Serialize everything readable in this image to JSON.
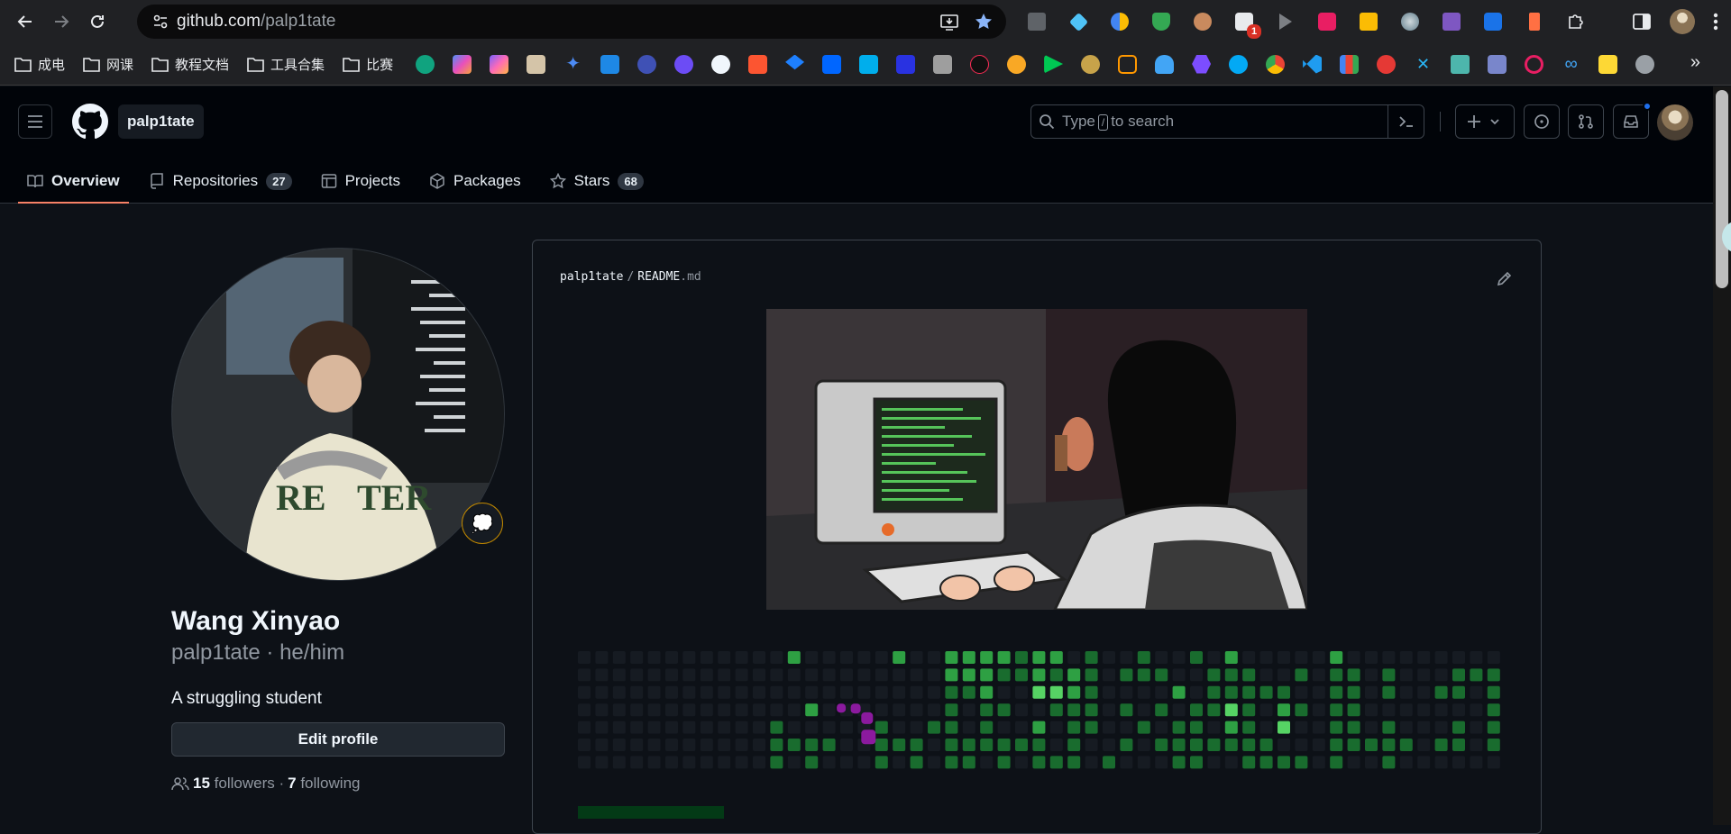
{
  "browser": {
    "url_host": "github.com",
    "url_path": "/palp1tate",
    "extension_badge": "1"
  },
  "bookmarks": {
    "folders": [
      "成电",
      "网课",
      "教程文档",
      "工具合集",
      "比赛"
    ],
    "more": "»"
  },
  "header": {
    "owner": "palp1tate",
    "search_label": "Type",
    "search_key": "/",
    "search_suffix": "to search"
  },
  "tabs": [
    {
      "label": "Overview"
    },
    {
      "label": "Repositories",
      "count": "27"
    },
    {
      "label": "Projects"
    },
    {
      "label": "Packages"
    },
    {
      "label": "Stars",
      "count": "68"
    }
  ],
  "profile": {
    "name": "Wang Xinyao",
    "login": "palp1tate · he/him",
    "bio": "A struggling student",
    "edit_label": "Edit profile",
    "followers_count": "15",
    "followers_label": "followers ·",
    "following_count": "7",
    "following_label": "following",
    "status_emoji": "💭"
  },
  "readme": {
    "owner": "palp1tate",
    "separator": "/",
    "file_base": "README",
    "file_ext": ".md"
  },
  "colors": {
    "accent_tab": "#f78166",
    "contrib_empty": "#161b22",
    "contrib_levels": [
      "#033a16",
      "#196c2e",
      "#2ea043",
      "#56d364"
    ],
    "snake": "#8b1a9e"
  },
  "contrib_grid": {
    "weeks": 53,
    "days": 7,
    "levels": [
      [
        0,
        0,
        0,
        0,
        0,
        0,
        0
      ],
      [
        0,
        0,
        0,
        0,
        0,
        0,
        0
      ],
      [
        0,
        0,
        0,
        0,
        0,
        0,
        0
      ],
      [
        0,
        0,
        0,
        0,
        0,
        0,
        0
      ],
      [
        0,
        0,
        0,
        0,
        0,
        0,
        0
      ],
      [
        0,
        0,
        0,
        0,
        0,
        0,
        0
      ],
      [
        0,
        0,
        0,
        0,
        0,
        0,
        0
      ],
      [
        0,
        0,
        0,
        0,
        0,
        0,
        0
      ],
      [
        0,
        0,
        0,
        0,
        0,
        0,
        0
      ],
      [
        0,
        0,
        0,
        0,
        0,
        0,
        0
      ],
      [
        0,
        0,
        0,
        0,
        0,
        0,
        0
      ],
      [
        0,
        0,
        0,
        0,
        1,
        1,
        1
      ],
      [
        2,
        0,
        0,
        0,
        0,
        1,
        0
      ],
      [
        0,
        0,
        0,
        2,
        0,
        1,
        1
      ],
      [
        0,
        0,
        0,
        0,
        0,
        1,
        0
      ],
      [
        0,
        0,
        0,
        0,
        0,
        0,
        0
      ],
      [
        0,
        0,
        0,
        0,
        0,
        0,
        0
      ],
      [
        0,
        0,
        0,
        0,
        1,
        1,
        1
      ],
      [
        2,
        0,
        0,
        0,
        0,
        1,
        0
      ],
      [
        0,
        0,
        0,
        0,
        0,
        1,
        1
      ],
      [
        0,
        0,
        0,
        0,
        1,
        0,
        0
      ],
      [
        2,
        2,
        1,
        1,
        1,
        1,
        1
      ],
      [
        2,
        2,
        1,
        0,
        0,
        1,
        1
      ],
      [
        2,
        2,
        2,
        1,
        1,
        1,
        0
      ],
      [
        2,
        1,
        0,
        1,
        0,
        1,
        1
      ],
      [
        1,
        1,
        0,
        0,
        0,
        1,
        0
      ],
      [
        2,
        2,
        3,
        0,
        2,
        1,
        1
      ],
      [
        2,
        1,
        3,
        1,
        0,
        0,
        1
      ],
      [
        0,
        2,
        2,
        1,
        1,
        1,
        1
      ],
      [
        1,
        1,
        1,
        1,
        1,
        0,
        0
      ],
      [
        0,
        0,
        0,
        0,
        0,
        0,
        1
      ],
      [
        0,
        1,
        0,
        1,
        0,
        1,
        0
      ],
      [
        1,
        1,
        0,
        0,
        1,
        0,
        0
      ],
      [
        0,
        1,
        0,
        1,
        0,
        1,
        0
      ],
      [
        0,
        0,
        2,
        0,
        1,
        1,
        1
      ],
      [
        1,
        0,
        0,
        1,
        1,
        1,
        1
      ],
      [
        0,
        1,
        1,
        1,
        0,
        1,
        0
      ],
      [
        2,
        1,
        1,
        3,
        2,
        1,
        0
      ],
      [
        0,
        1,
        1,
        1,
        1,
        1,
        1
      ],
      [
        0,
        0,
        1,
        0,
        0,
        1,
        1
      ],
      [
        0,
        0,
        1,
        2,
        3,
        0,
        1
      ],
      [
        0,
        1,
        0,
        1,
        0,
        0,
        1
      ],
      [
        0,
        0,
        0,
        0,
        0,
        0,
        0
      ],
      [
        2,
        1,
        1,
        1,
        1,
        1,
        1
      ],
      [
        0,
        1,
        1,
        1,
        1,
        1,
        0
      ],
      [
        0,
        0,
        0,
        0,
        0,
        1,
        0
      ],
      [
        0,
        1,
        1,
        0,
        1,
        1,
        1
      ],
      [
        0,
        0,
        0,
        0,
        0,
        1,
        0
      ],
      [
        0,
        0,
        0,
        0,
        0,
        0,
        0
      ],
      [
        0,
        0,
        1,
        0,
        0,
        1,
        0
      ],
      [
        0,
        1,
        1,
        0,
        1,
        1,
        0
      ],
      [
        0,
        1,
        0,
        0,
        0,
        0,
        0
      ],
      [
        0,
        1,
        1,
        1,
        1,
        1,
        0
      ]
    ]
  }
}
